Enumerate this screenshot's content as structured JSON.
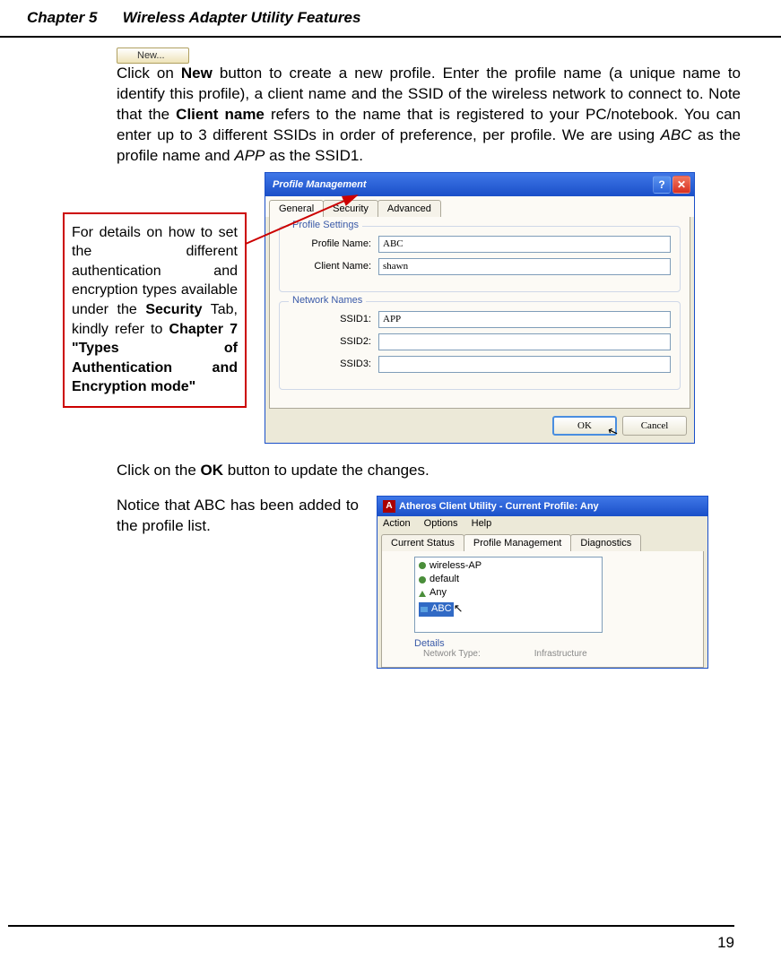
{
  "header": {
    "chapter": "Chapter 5",
    "title": "Wireless Adapter Utility Features"
  },
  "new_button_label": "New...",
  "paragraph1": {
    "p1": "Click on ",
    "p2_bold": "New",
    "p3": " button to create a new profile. Enter the profile name (a unique name to identify this profile), a client name and the SSID of the wireless network to connect to. Note that the ",
    "p4_bold": "Client name",
    "p5": " refers to the name that is registered to your PC/notebook. You can enter up to 3 different SSIDs in order of preference, per profile. We are using ",
    "p6_italic": "ABC",
    "p7": " as the profile name and ",
    "p8_italic": "APP",
    "p9": " as the SSID1."
  },
  "info_box": {
    "t1": "For details on how to set the different authentication and encryption types available under the ",
    "t2_bold": "Security",
    "t3": " Tab, kindly refer to ",
    "t4_bold": "Chapter 7 \"Types of Authentication and Encryption mode\""
  },
  "dialog1": {
    "title": "Profile Management",
    "tabs": {
      "general": "General",
      "security": "Security",
      "advanced": "Advanced"
    },
    "group1_title": "Profile Settings",
    "profile_name_label": "Profile Name:",
    "profile_name_value": "ABC",
    "client_name_label": "Client Name:",
    "client_name_value": "shawn",
    "group2_title": "Network Names",
    "ssid1_label": "SSID1:",
    "ssid1_value": "APP",
    "ssid2_label": "SSID2:",
    "ssid2_value": "",
    "ssid3_label": "SSID3:",
    "ssid3_value": "",
    "ok": "OK",
    "cancel": "Cancel"
  },
  "paragraph2": {
    "p1": "Click on the ",
    "p2_bold": "OK",
    "p3": " button to update the changes."
  },
  "notice_text": "Notice that ABC has been added to the profile list.",
  "dialog2": {
    "title": "Atheros Client Utility - Current Profile: Any",
    "menu": {
      "action": "Action",
      "options": "Options",
      "help": "Help"
    },
    "tabs": {
      "current": "Current Status",
      "profile": "Profile Management",
      "diag": "Diagnostics"
    },
    "list": {
      "item1": "wireless-AP",
      "item2": "default",
      "item3": "Any",
      "item4": "ABC"
    },
    "details_label": "Details",
    "details_sub1": "Network Type:",
    "details_sub2": "Infrastructure"
  },
  "page_number": "19"
}
